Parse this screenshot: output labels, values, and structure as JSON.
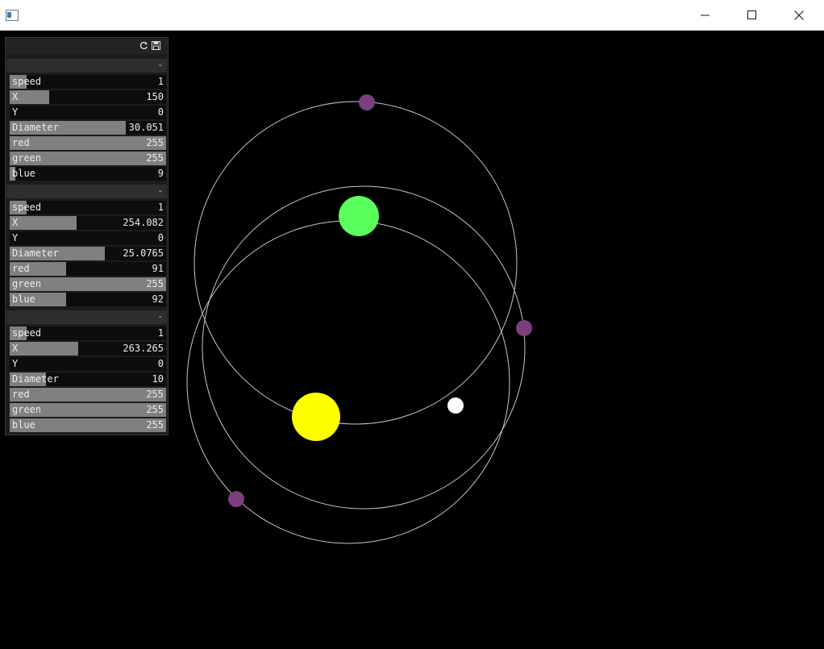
{
  "window": {
    "title": "",
    "controls": [
      "minimize",
      "maximize",
      "close"
    ]
  },
  "gui": {
    "header_icons": [
      "reload-icon",
      "save-icon"
    ],
    "groups": [
      {
        "collapse_symbol": "-",
        "sliders": [
          {
            "label": "speed",
            "value": "1",
            "fill": 0.11
          },
          {
            "label": "X",
            "value": "150",
            "fill": 0.25
          },
          {
            "label": "Y",
            "value": "0",
            "fill": 0.0
          },
          {
            "label": "Diameter",
            "value": "30.051",
            "fill": 0.74
          },
          {
            "label": "red",
            "value": "255",
            "fill": 1.0
          },
          {
            "label": "green",
            "value": "255",
            "fill": 1.0
          },
          {
            "label": "blue",
            "value": "9",
            "fill": 0.035
          }
        ]
      },
      {
        "collapse_symbol": "-",
        "sliders": [
          {
            "label": "speed",
            "value": "1",
            "fill": 0.11
          },
          {
            "label": "X",
            "value": "254.082",
            "fill": 0.43
          },
          {
            "label": "Y",
            "value": "0",
            "fill": 0.0
          },
          {
            "label": "Diameter",
            "value": "25.0765",
            "fill": 0.61
          },
          {
            "label": "red",
            "value": "91",
            "fill": 0.36
          },
          {
            "label": "green",
            "value": "255",
            "fill": 1.0
          },
          {
            "label": "blue",
            "value": "92",
            "fill": 0.36
          }
        ]
      },
      {
        "collapse_symbol": "-",
        "sliders": [
          {
            "label": "speed",
            "value": "1",
            "fill": 0.11
          },
          {
            "label": "X",
            "value": "263.265",
            "fill": 0.44
          },
          {
            "label": "Y",
            "value": "0",
            "fill": 0.0
          },
          {
            "label": "Diameter",
            "value": "10",
            "fill": 0.23
          },
          {
            "label": "red",
            "value": "255",
            "fill": 1.0
          },
          {
            "label": "green",
            "value": "255",
            "fill": 1.0
          },
          {
            "label": "blue",
            "value": "255",
            "fill": 1.0
          }
        ]
      }
    ]
  },
  "colors": {
    "background": "#000000",
    "orbit": "#c8c8c8",
    "sun": "#ffff00",
    "green_planet": "#5bff5c",
    "white_planet": "#ffffff",
    "moon": "#7a3f7c",
    "slider_fill": "#808080"
  }
}
